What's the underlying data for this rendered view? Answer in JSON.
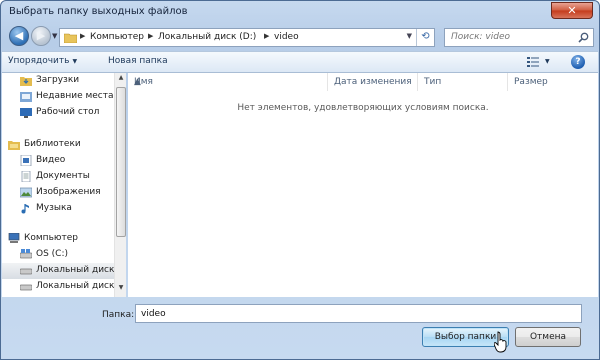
{
  "window": {
    "title": "Выбрать папку выходных файлов",
    "close_label": "✕"
  },
  "navigation": {
    "back_icon": "back-arrow-icon",
    "forward_icon": "forward-arrow-icon"
  },
  "address": {
    "crumbs": [
      "Компьютер",
      "Локальный диск (D:)",
      "video"
    ],
    "separator": "▶"
  },
  "search": {
    "placeholder": "Поиск: video"
  },
  "toolbar": {
    "organize_label": "Упорядочить",
    "new_folder_label": "Новая папка",
    "help_label": "?"
  },
  "navpane": {
    "items": [
      {
        "label": "Загрузки",
        "icon": "downloads-folder-icon",
        "selected": false
      },
      {
        "label": "Недавние места",
        "icon": "recent-places-icon",
        "selected": false
      },
      {
        "label": "Рабочий стол",
        "icon": "desktop-icon",
        "selected": false
      },
      {
        "label": "Библиотеки",
        "icon": "libraries-icon",
        "selected": false
      },
      {
        "label": "Видео",
        "icon": "video-library-icon",
        "selected": false
      },
      {
        "label": "Документы",
        "icon": "documents-library-icon",
        "selected": false
      },
      {
        "label": "Изображения",
        "icon": "pictures-library-icon",
        "selected": false
      },
      {
        "label": "Музыка",
        "icon": "music-library-icon",
        "selected": false
      },
      {
        "label": "Компьютер",
        "icon": "computer-icon",
        "selected": false
      },
      {
        "label": "OS (C:)",
        "icon": "os-drive-icon",
        "selected": false
      },
      {
        "label": "Локальный диск",
        "icon": "local-drive-icon",
        "selected": true
      },
      {
        "label": "Локальный диск",
        "icon": "local-drive-icon",
        "selected": false
      }
    ]
  },
  "filelist": {
    "columns": [
      "Имя",
      "Дата изменения",
      "Тип",
      "Размер"
    ],
    "empty_message": "Нет элементов, удовлетворяющих условиям поиска."
  },
  "bottom": {
    "folder_label": "Папка:",
    "folder_value": "video",
    "select_button": "Выбор папки",
    "cancel_button": "Отмена"
  },
  "colors": {
    "accent": "#3c7fb1",
    "frame": "#c6d9ef",
    "close": "#c43a1a"
  }
}
